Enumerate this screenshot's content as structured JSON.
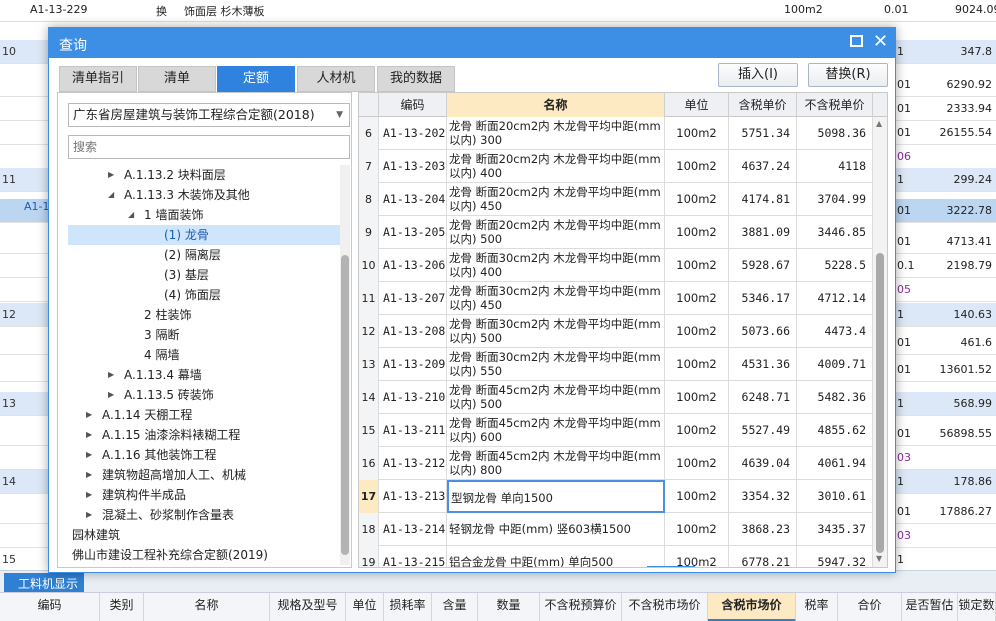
{
  "background": {
    "top_row": {
      "idx_code": "A1-13-229",
      "type": "换",
      "name": "饰面层 杉木薄板",
      "unit": "100m2",
      "qty": "0.01",
      "price": "9024.09"
    },
    "rows": [
      {
        "idx": "10",
        "right": "1",
        "val": "347.8",
        "style": "blue"
      },
      {
        "idx": "",
        "right": "01",
        "val": "6290.92",
        "style": ""
      },
      {
        "idx": "",
        "right": "01",
        "val": "2333.94",
        "style": ""
      },
      {
        "idx": "",
        "right": "01",
        "val": "26155.54",
        "style": ""
      },
      {
        "idx": "",
        "right": "06",
        "val": "",
        "style": "purple"
      },
      {
        "idx": "11",
        "right": "1",
        "val": "299.24",
        "style": "blue"
      },
      {
        "idx": "",
        "right": "01",
        "val": "3222.78",
        "style": "sel"
      },
      {
        "idx": "",
        "right": "01",
        "val": "4713.41",
        "style": ""
      },
      {
        "idx": "",
        "right": "0.1",
        "val": "2198.79",
        "style": ""
      },
      {
        "idx": "",
        "right": "05",
        "val": "",
        "style": "purple"
      },
      {
        "idx": "12",
        "right": "1",
        "val": "140.63",
        "style": "blue"
      },
      {
        "idx": "",
        "right": "01",
        "val": "461.6",
        "style": ""
      },
      {
        "idx": "",
        "right": "01",
        "val": "13601.52",
        "style": ""
      },
      {
        "idx": "13",
        "right": "1",
        "val": "568.99",
        "style": "blue"
      },
      {
        "idx": "",
        "right": "01",
        "val": "56898.55",
        "style": ""
      },
      {
        "idx": "",
        "right": "03",
        "val": "",
        "style": "purple"
      },
      {
        "idx": "14",
        "right": "1",
        "val": "178.86",
        "style": "blue"
      },
      {
        "idx": "",
        "right": "01",
        "val": "17886.27",
        "style": ""
      },
      {
        "idx": "",
        "right": "03",
        "val": "",
        "style": "purple"
      },
      {
        "idx": "15",
        "right": "1",
        "val": "",
        "style": ""
      }
    ],
    "selected_cell": "A1-1",
    "bottom_tab": "工料机显示",
    "bottom_columns": [
      "编码",
      "类别",
      "名称",
      "规格及型号",
      "单位",
      "损耗率",
      "含量",
      "数量",
      "不含税预算价",
      "不含税市场价",
      "含税市场价",
      "税率",
      "合价",
      "是否暂估",
      "锁定数"
    ]
  },
  "dialog": {
    "title": "查询",
    "tabs": [
      "清单指引",
      "清单",
      "定额",
      "人材机",
      "我的数据"
    ],
    "active_tab": "定额",
    "insert_label": "插入(I)",
    "replace_label": "替换(R)"
  },
  "left": {
    "quota_library": "广东省房屋建筑与装饰工程综合定额(2018)",
    "search_placeholder": "搜索",
    "tree": [
      {
        "label": "A.1.13.2 块料面层",
        "level": 3,
        "arrow": "right",
        "selected": false
      },
      {
        "label": "A.1.13.3 木装饰及其他",
        "level": 3,
        "arrow": "down",
        "selected": false
      },
      {
        "label": "1 墙面装饰",
        "level": 4,
        "arrow": "down",
        "selected": false
      },
      {
        "label": "(1) 龙骨",
        "level": 5,
        "arrow": "",
        "selected": true
      },
      {
        "label": "(2) 隔离层",
        "level": 5,
        "arrow": "",
        "selected": false
      },
      {
        "label": "(3) 基层",
        "level": 5,
        "arrow": "",
        "selected": false
      },
      {
        "label": "(4) 饰面层",
        "level": 5,
        "arrow": "",
        "selected": false
      },
      {
        "label": "2 柱装饰",
        "level": 4,
        "arrow": "",
        "selected": false
      },
      {
        "label": "3 隔断",
        "level": 4,
        "arrow": "",
        "selected": false
      },
      {
        "label": "4 隔墙",
        "level": 4,
        "arrow": "",
        "selected": false
      },
      {
        "label": "A.1.13.4 幕墙",
        "level": 3,
        "arrow": "right",
        "selected": false
      },
      {
        "label": "A.1.13.5 砖装饰",
        "level": 3,
        "arrow": "right",
        "selected": false
      },
      {
        "label": "A.1.14 天棚工程",
        "level": 2,
        "arrow": "right",
        "selected": false
      },
      {
        "label": "A.1.15 油漆涂料裱糊工程",
        "level": 2,
        "arrow": "right",
        "selected": false
      },
      {
        "label": "A.1.16 其他装饰工程",
        "level": 2,
        "arrow": "right",
        "selected": false
      },
      {
        "label": "建筑物超高增加人工、机械",
        "level": 2,
        "arrow": "right",
        "selected": false
      },
      {
        "label": "建筑构件半成品",
        "level": 2,
        "arrow": "right",
        "selected": false
      },
      {
        "label": "混凝土、砂浆制作含量表",
        "level": 2,
        "arrow": "right",
        "selected": false
      },
      {
        "label": "园林建筑",
        "level": 1,
        "arrow": "right",
        "selected": false
      },
      {
        "label": "佛山市建设工程补充综合定额(2019)",
        "level": 1,
        "arrow": "right",
        "selected": false
      }
    ]
  },
  "grid": {
    "columns": [
      "",
      "编码",
      "名称",
      "单位",
      "含税单价",
      "不含税单价"
    ],
    "rows": [
      {
        "idx": "6",
        "code": "A1-13-202",
        "name": "龙骨 断面20cm2内 木龙骨平均中距(mm以内) 300",
        "unit": "100m2",
        "tax_price": "5751.34",
        "notax_price": "5098.36"
      },
      {
        "idx": "7",
        "code": "A1-13-203",
        "name": "龙骨 断面20cm2内 木龙骨平均中距(mm以内) 400",
        "unit": "100m2",
        "tax_price": "4637.24",
        "notax_price": "4118"
      },
      {
        "idx": "8",
        "code": "A1-13-204",
        "name": "龙骨 断面20cm2内 木龙骨平均中距(mm以内) 450",
        "unit": "100m2",
        "tax_price": "4174.81",
        "notax_price": "3704.99"
      },
      {
        "idx": "9",
        "code": "A1-13-205",
        "name": "龙骨 断面20cm2内 木龙骨平均中距(mm以内) 500",
        "unit": "100m2",
        "tax_price": "3881.09",
        "notax_price": "3446.85"
      },
      {
        "idx": "10",
        "code": "A1-13-206",
        "name": "龙骨 断面30cm2内 木龙骨平均中距(mm以内) 400",
        "unit": "100m2",
        "tax_price": "5928.67",
        "notax_price": "5228.5"
      },
      {
        "idx": "11",
        "code": "A1-13-207",
        "name": "龙骨 断面30cm2内 木龙骨平均中距(mm以内) 450",
        "unit": "100m2",
        "tax_price": "5346.17",
        "notax_price": "4712.14"
      },
      {
        "idx": "12",
        "code": "A1-13-208",
        "name": "龙骨 断面30cm2内 木龙骨平均中距(mm以内) 500",
        "unit": "100m2",
        "tax_price": "5073.66",
        "notax_price": "4473.4"
      },
      {
        "idx": "13",
        "code": "A1-13-209",
        "name": "龙骨 断面30cm2内 木龙骨平均中距(mm以内) 550",
        "unit": "100m2",
        "tax_price": "4531.36",
        "notax_price": "4009.71"
      },
      {
        "idx": "14",
        "code": "A1-13-210",
        "name": "龙骨 断面45cm2内 木龙骨平均中距(mm以内) 500",
        "unit": "100m2",
        "tax_price": "6248.71",
        "notax_price": "5482.36"
      },
      {
        "idx": "15",
        "code": "A1-13-211",
        "name": "龙骨 断面45cm2内 木龙骨平均中距(mm以内) 600",
        "unit": "100m2",
        "tax_price": "5527.49",
        "notax_price": "4855.62"
      },
      {
        "idx": "16",
        "code": "A1-13-212",
        "name": "龙骨 断面45cm2内 木龙骨平均中距(mm以内) 800",
        "unit": "100m2",
        "tax_price": "4639.04",
        "notax_price": "4061.94"
      },
      {
        "idx": "17",
        "code": "A1-13-213",
        "name": "型钢龙骨 单向1500",
        "unit": "100m2",
        "tax_price": "3354.32",
        "notax_price": "3010.61"
      },
      {
        "idx": "18",
        "code": "A1-13-214",
        "name": "轻钢龙骨 中距(mm) 竖603横1500",
        "unit": "100m2",
        "tax_price": "3868.23",
        "notax_price": "3435.37"
      },
      {
        "idx": "19",
        "code": "A1-13-215",
        "name": "铝合金龙骨 中距(mm) 单向500",
        "unit": "100m2",
        "tax_price": "6778.21",
        "notax_price": "5947.32"
      }
    ],
    "current_row": "17"
  }
}
